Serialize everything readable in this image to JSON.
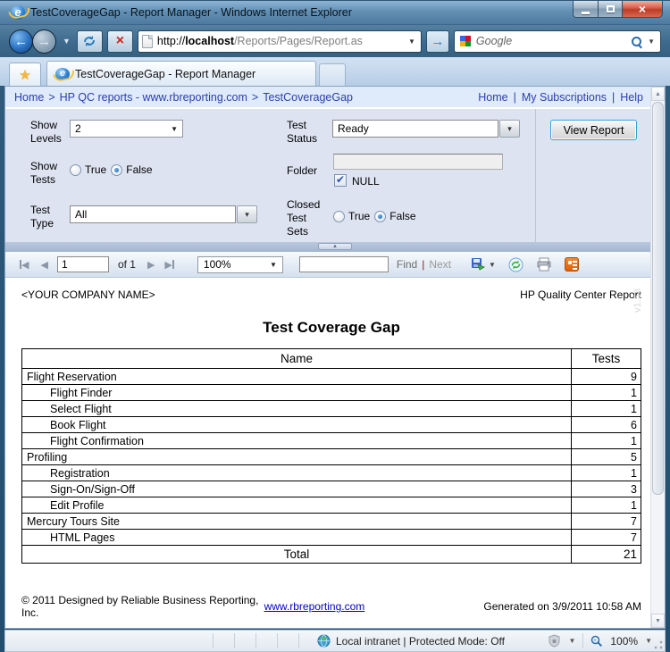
{
  "window": {
    "title": "TestCoverageGap - Report Manager - Windows Internet Explorer"
  },
  "address_bar": {
    "url_protocol": "http://",
    "url_host": "localhost",
    "url_path": "/Reports/Pages/Report.as",
    "search_placeholder": "Google"
  },
  "tab": {
    "title": "TestCoverageGap - Report Manager"
  },
  "breadcrumb": {
    "items": [
      "Home",
      "HP QC reports - www.rbreporting.com",
      "TestCoverageGap"
    ],
    "separator": ">",
    "links": [
      "Home",
      "My Subscriptions",
      "Help"
    ],
    "link_separator": "|"
  },
  "parameters": {
    "show_levels": {
      "label": "Show Levels",
      "value": "2"
    },
    "test_status": {
      "label": "Test Status",
      "value": "Ready"
    },
    "show_tests": {
      "label": "Show Tests",
      "true_label": "True",
      "false_label": "False",
      "selected": "False"
    },
    "folder": {
      "label": "Folder",
      "value": "",
      "null_label": "NULL",
      "null_checked": true
    },
    "test_type": {
      "label": "Test Type",
      "value": "All"
    },
    "closed_test_sets": {
      "label": "Closed Test Sets",
      "true_label": "True",
      "false_label": "False",
      "selected": "False"
    },
    "view_report": "View Report"
  },
  "viewer_toolbar": {
    "page": "1",
    "of": "of 1",
    "zoom": "100%",
    "find": "Find",
    "find_separator": "|",
    "next": "Next"
  },
  "report": {
    "company": "<YOUR COMPANY NAME>",
    "right_header": "HP Quality Center Report",
    "watermark": "v1.53",
    "title": "Test Coverage Gap",
    "table": {
      "columns": [
        "Name",
        "Tests"
      ],
      "rows": [
        {
          "name": "Flight Reservation",
          "tests": 9,
          "indent": 0
        },
        {
          "name": "Flight Finder",
          "tests": 1,
          "indent": 1
        },
        {
          "name": "Select Flight",
          "tests": 1,
          "indent": 1
        },
        {
          "name": "Book Flight",
          "tests": 6,
          "indent": 1
        },
        {
          "name": "Flight Confirmation",
          "tests": 1,
          "indent": 1
        },
        {
          "name": "Profiling",
          "tests": 5,
          "indent": 0
        },
        {
          "name": "Registration",
          "tests": 1,
          "indent": 1
        },
        {
          "name": "Sign-On/Sign-Off",
          "tests": 3,
          "indent": 1
        },
        {
          "name": "Edit Profile",
          "tests": 1,
          "indent": 1
        },
        {
          "name": "Mercury Tours Site",
          "tests": 7,
          "indent": 0
        },
        {
          "name": "HTML Pages",
          "tests": 7,
          "indent": 1
        }
      ],
      "total_label": "Total",
      "total_value": 21
    },
    "footer": {
      "copyright": "© 2011 Designed by Reliable Business Reporting, Inc.",
      "link": "www.rbreporting.com",
      "generated": "Generated on 3/9/2011 10:58 AM"
    }
  },
  "status_bar": {
    "zone": "Local intranet | Protected Mode: Off",
    "zoom": "100%"
  },
  "icons": {
    "back": "←",
    "forward": "→",
    "go": "→",
    "stop": "×",
    "close": "×",
    "star": "★",
    "caret": "▼",
    "chevron": "▾",
    "check": "✔",
    "first_page": "◀",
    "prev_page": "◀",
    "next_page": "▶",
    "last_page": "▶",
    "scroll_up": "▲",
    "scroll_down": "▼",
    "split_up": "▲"
  },
  "colors": {
    "link_blue": "#2b3fae",
    "report_link_blue": "#0000cc",
    "feed_orange": "#dd5f07",
    "close_red": "#bc3d26",
    "accent_blue": "#38a0d8"
  }
}
